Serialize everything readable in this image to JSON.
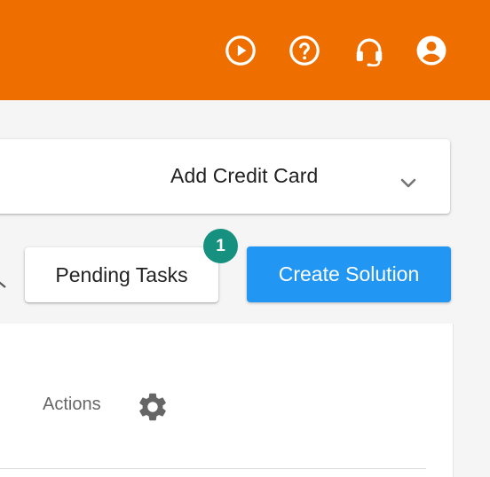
{
  "header": {
    "background_color": "#ee6f00",
    "icons": [
      "play-circle-icon",
      "help-circle-icon",
      "headset-icon",
      "account-circle-icon"
    ]
  },
  "credit_card_bar": {
    "label": "Add Credit Card",
    "expand_icon": "chevron-down-icon"
  },
  "toolbar": {
    "pending_label": "Pending Tasks",
    "pending_count": "1",
    "badge_color": "#16917f",
    "create_label": "Create Solution",
    "create_color": "#2196f3"
  },
  "table": {
    "actions_label": "Actions",
    "settings_icon": "gear-icon"
  }
}
